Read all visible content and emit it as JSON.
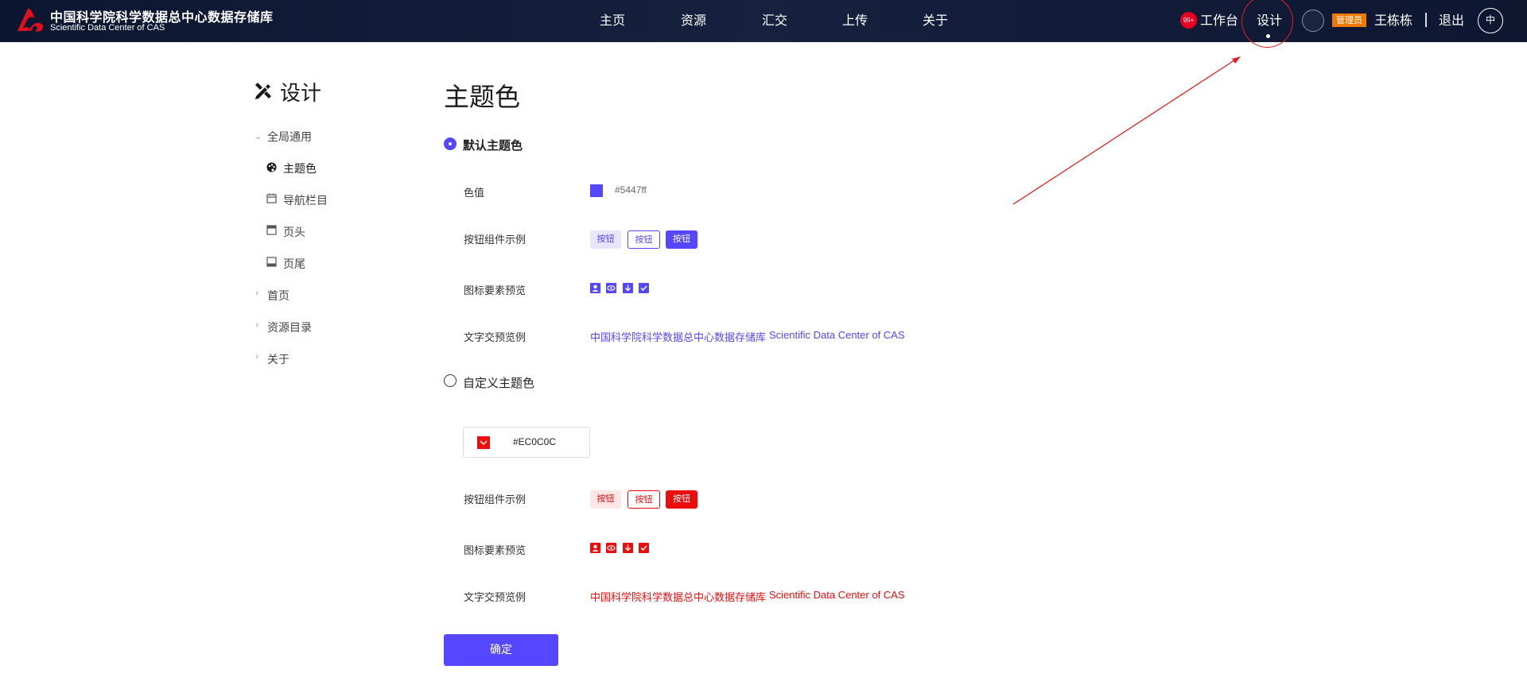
{
  "header": {
    "brand_cn": "中国科学院科学数据总中心数据存储库",
    "brand_en": "Scientific Data Center of CAS",
    "nav": [
      "主页",
      "资源",
      "汇交",
      "上传",
      "关于"
    ],
    "badge": "99+",
    "workbench": "工作台",
    "design": "设计",
    "role_tag": "管理员",
    "username": "王栋栋",
    "logout": "退出",
    "lang": "中"
  },
  "sidebar": {
    "title": "设计",
    "groups": [
      {
        "label": "全局通用",
        "expanded": true,
        "items": [
          {
            "label": "主题色",
            "icon": "palette-icon",
            "active": true
          },
          {
            "label": "导航栏目",
            "icon": "calendar-icon"
          },
          {
            "label": "页头",
            "icon": "page-header-icon"
          },
          {
            "label": "页尾",
            "icon": "page-footer-icon"
          }
        ]
      },
      {
        "label": "首页",
        "expanded": false
      },
      {
        "label": "资源目录",
        "expanded": false
      },
      {
        "label": "关于",
        "expanded": false
      }
    ]
  },
  "main": {
    "title": "主题色",
    "default_option": {
      "label": "默认主题色",
      "selected": true,
      "color_label": "色值",
      "color_value": "#5447ff",
      "buttons_label": "按钮组件示例",
      "button_text": "按钮",
      "icons_label": "图标要素预览",
      "text_label": "文字交预览例",
      "preview_cn": "中国科学院科学数据总中心数据存储库",
      "preview_en": "Scientific Data Center of CAS"
    },
    "custom_option": {
      "label": "自定义主题色",
      "selected": false,
      "color_value": "#EC0C0C",
      "buttons_label": "按钮组件示例",
      "button_text": "按钮",
      "icons_label": "图标要素预览",
      "text_label": "文字交预览例",
      "preview_cn": "中国科学院科学数据总中心数据存储库",
      "preview_en": "Scientific Data Center of CAS"
    },
    "confirm_label": "确定"
  },
  "colors": {
    "primary": "#5447ff",
    "custom": "#ec0c0c",
    "nav_bg": "#111a35",
    "admin_tag": "#f07a00",
    "badge": "#e7001f"
  }
}
